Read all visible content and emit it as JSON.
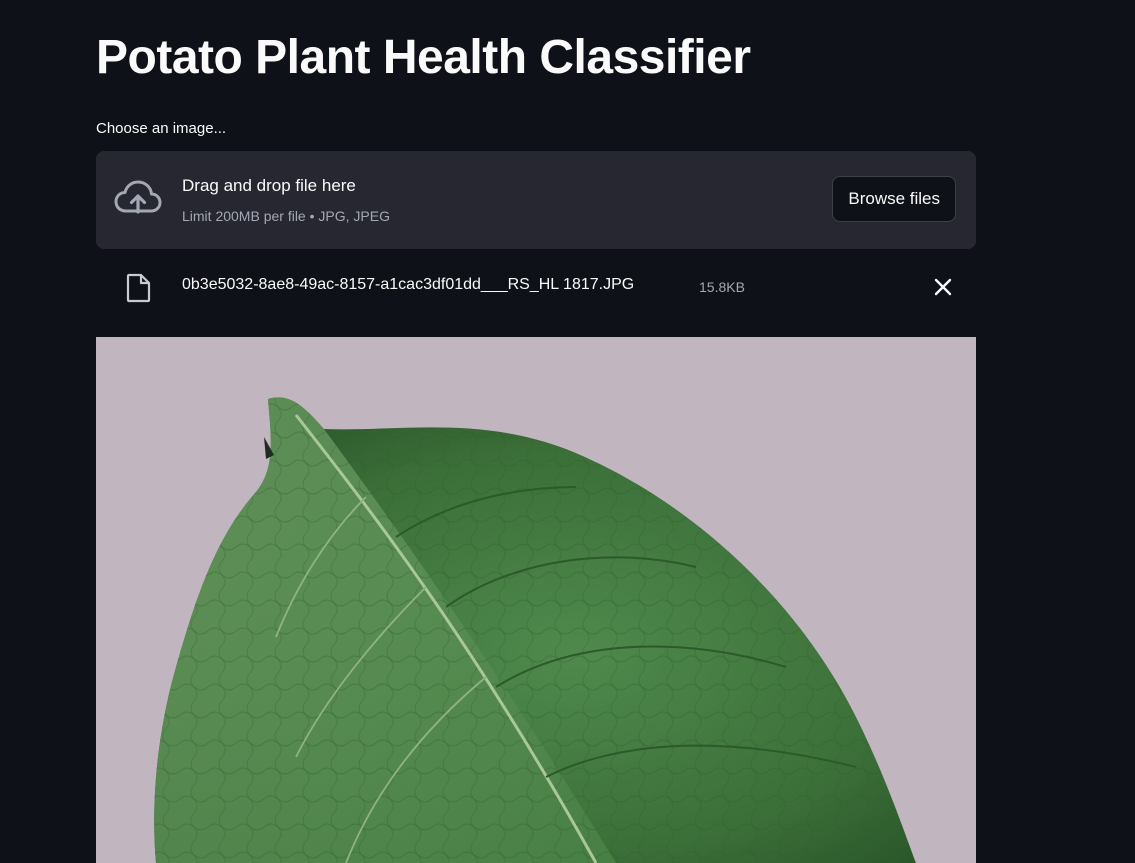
{
  "page": {
    "title": "Potato Plant Health Classifier"
  },
  "uploader": {
    "label": "Choose an image...",
    "drop_text": "Drag and drop file here",
    "limit_text": "Limit 200MB per file • JPG, JPEG",
    "browse_label": "Browse files"
  },
  "uploaded_file": {
    "name": "0b3e5032-8ae8-49ac-8157-a1cac3df01dd___RS_HL 1817.JPG",
    "size": "15.8KB"
  },
  "icons": {
    "upload": "cloud-upload-icon",
    "file": "file-icon",
    "close": "close-icon"
  },
  "colors": {
    "background": "#0e1117",
    "dropzone": "#262730",
    "text": "#fafafa",
    "muted_text": "#a3a8b4",
    "photo_background": "#c1b6bf",
    "leaf_green": "#3f7a3e"
  }
}
